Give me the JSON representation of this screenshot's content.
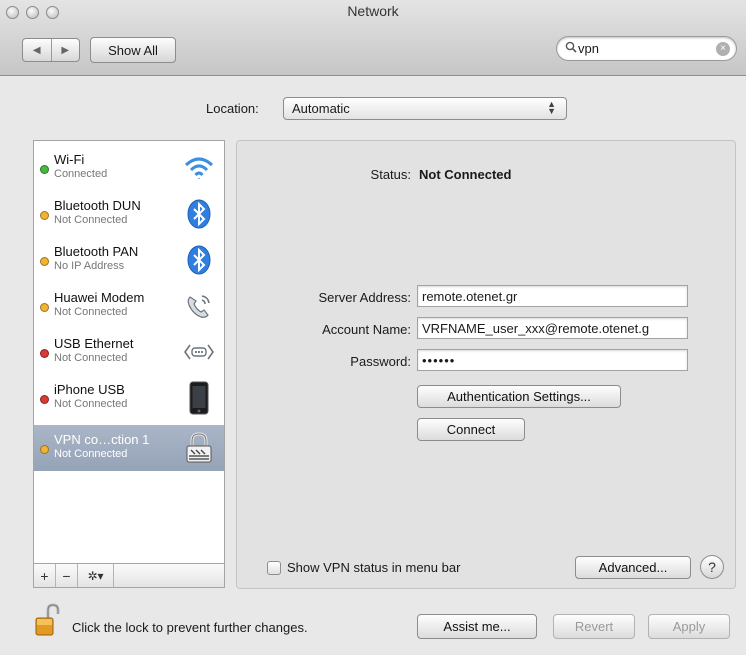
{
  "window": {
    "title": "Network"
  },
  "toolbar": {
    "back_glyph": "◀",
    "forward_glyph": "▶",
    "show_all_label": "Show All",
    "search_value": "vpn"
  },
  "location": {
    "label": "Location:",
    "value": "Automatic"
  },
  "services": [
    {
      "name": "Wi-Fi",
      "status": "Connected",
      "dot_color": "#46b93e",
      "icon": "wifi-icon"
    },
    {
      "name": "Bluetooth DUN",
      "status": "Not Connected",
      "dot_color": "#f0b332",
      "icon": "bluetooth-icon"
    },
    {
      "name": "Bluetooth PAN",
      "status": "No IP Address",
      "dot_color": "#f0b332",
      "icon": "bluetooth-icon"
    },
    {
      "name": "Huawei Modem",
      "status": "Not Connected",
      "dot_color": "#f0b332",
      "icon": "modem-phone-icon"
    },
    {
      "name": "USB Ethernet",
      "status": "Not Connected",
      "dot_color": "#d63a34",
      "icon": "ethernet-icon"
    },
    {
      "name": "iPhone USB",
      "status": "Not Connected",
      "dot_color": "#d63a34",
      "icon": "iphone-icon"
    },
    {
      "name": "VPN co…ction 1",
      "status": "Not Connected",
      "dot_color": "#f0b332",
      "icon": "vpn-lock-icon",
      "selected": true
    }
  ],
  "sidebar_tools": {
    "add": "+",
    "remove": "−",
    "gear": "✲▾"
  },
  "detail": {
    "status_label": "Status:",
    "status_value": "Not Connected",
    "server_label": "Server Address:",
    "server_value": "remote.otenet.gr",
    "account_label": "Account Name:",
    "account_value": "VRFNAME_user_xxx@remote.otenet.g",
    "password_label": "Password:",
    "password_value": "••••••",
    "auth_button": "Authentication Settings...",
    "connect_button": "Connect",
    "show_status_label": "Show VPN status in menu bar",
    "advanced_button": "Advanced...",
    "help_glyph": "?"
  },
  "footer": {
    "lock_text": "Click the lock to prevent further changes.",
    "assist_button": "Assist me...",
    "revert_button": "Revert",
    "apply_button": "Apply"
  }
}
